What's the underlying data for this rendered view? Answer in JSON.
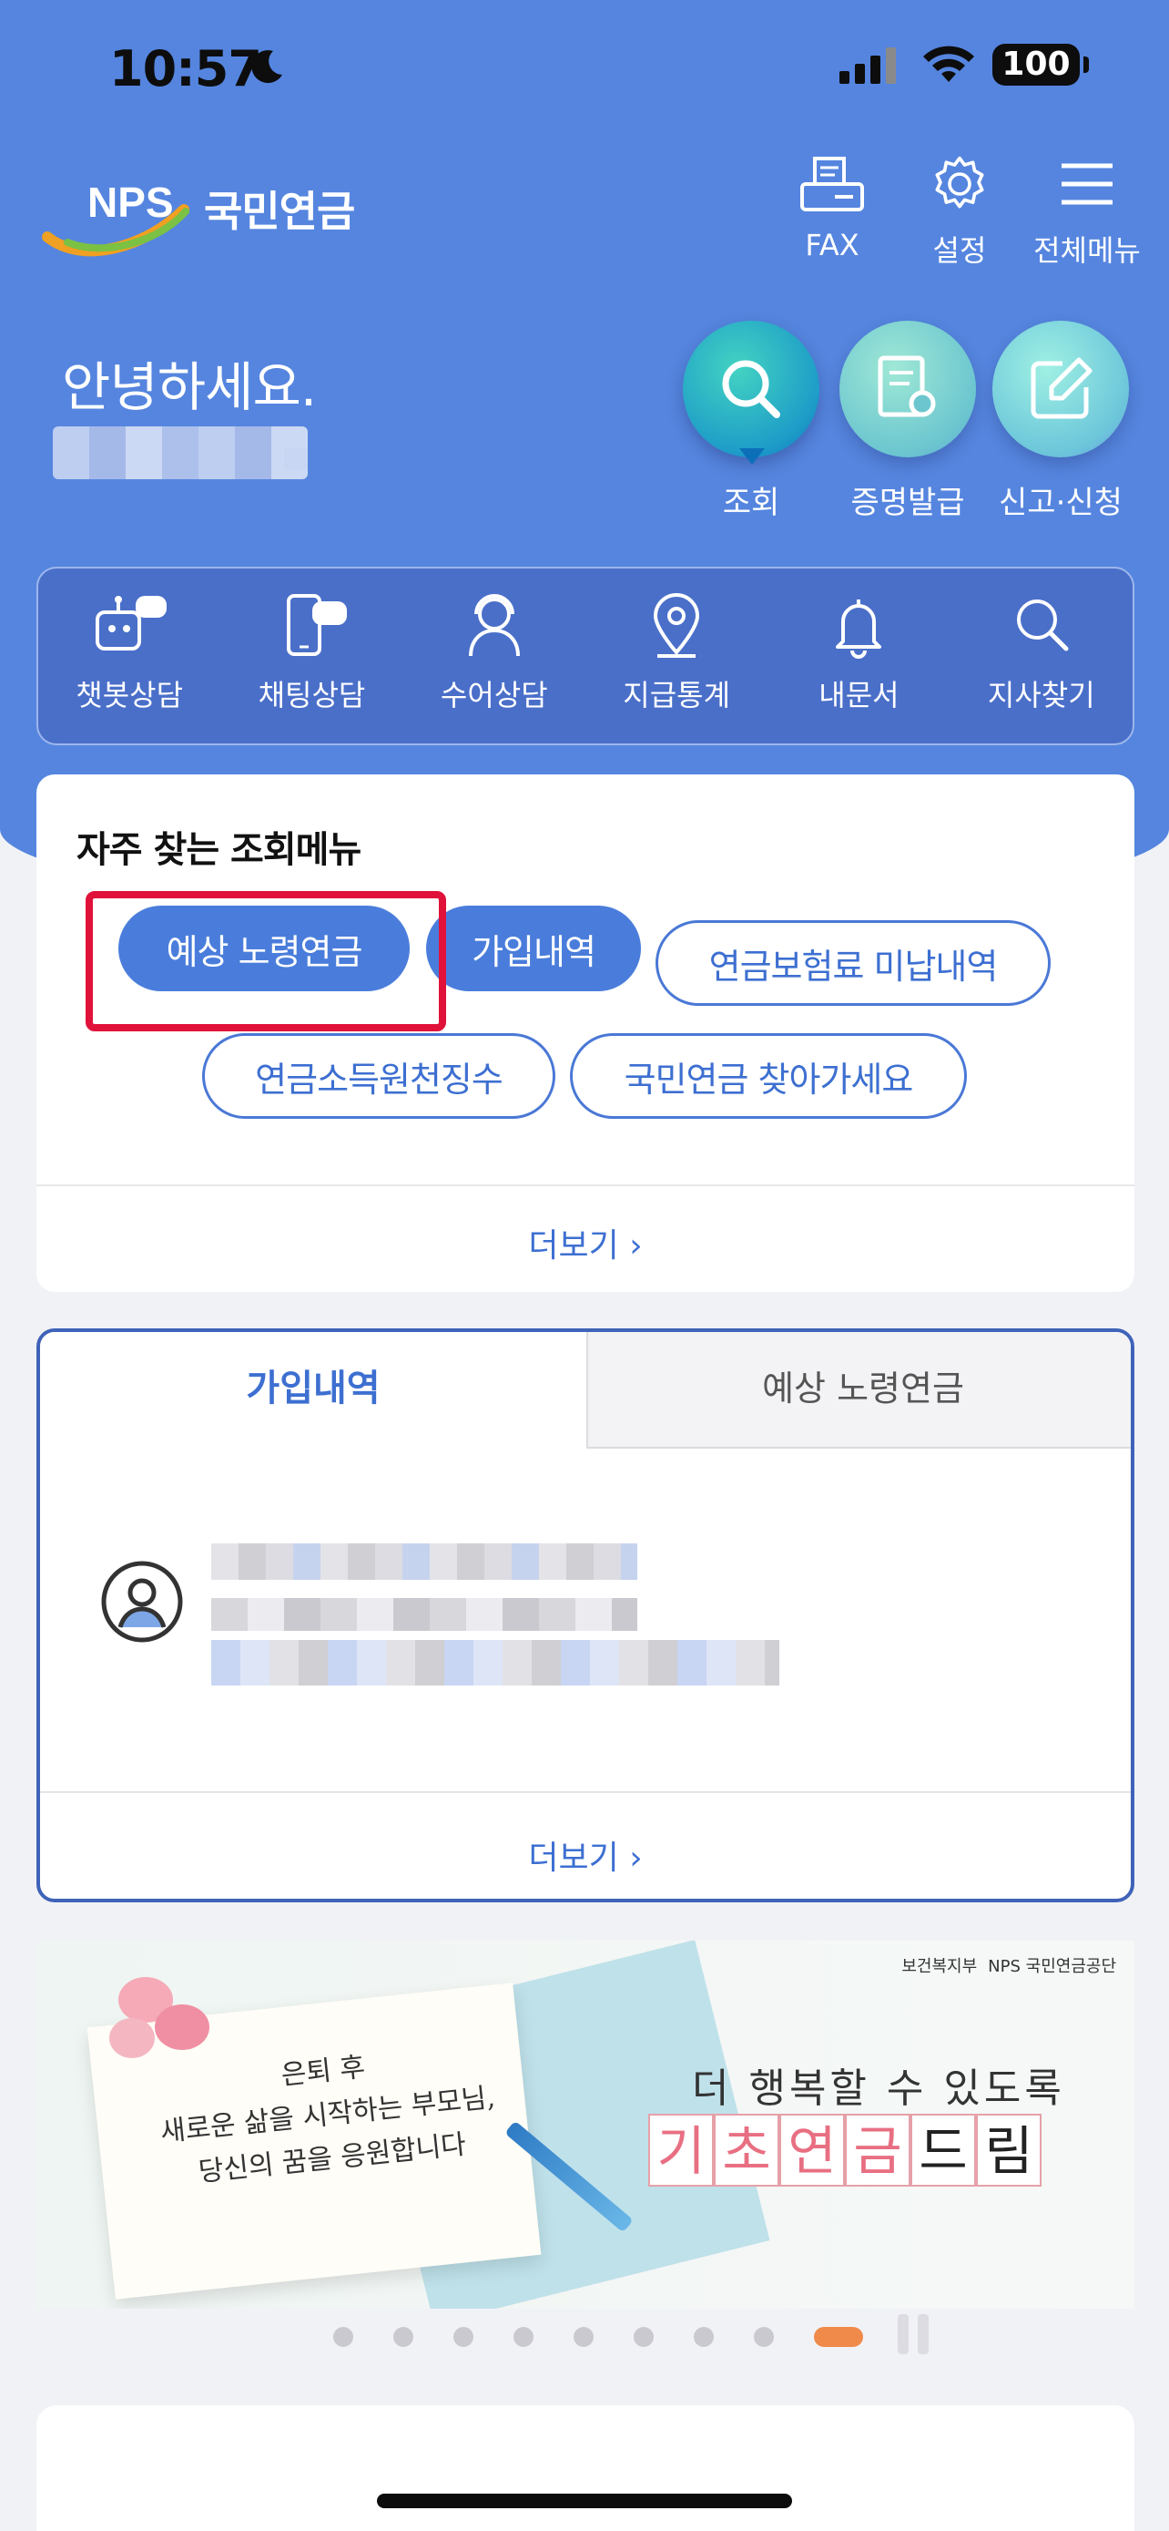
{
  "status_bar": {
    "time": "10:57",
    "battery": "100"
  },
  "header": {
    "logo_text": "NPS 국민연금",
    "actions": [
      {
        "label": "FAX",
        "icon": "fax-icon"
      },
      {
        "label": "설정",
        "icon": "gear-icon"
      },
      {
        "label": "전체메뉴",
        "icon": "hamburger-menu-icon"
      }
    ]
  },
  "greeting": {
    "text": "안녕하세요."
  },
  "quick_menu": [
    {
      "label": "조회",
      "icon": "search-icon"
    },
    {
      "label": "증명발급",
      "icon": "certificate-icon"
    },
    {
      "label": "신고·신청",
      "icon": "edit-icon"
    }
  ],
  "services": [
    {
      "label": "챗봇상담",
      "icon": "chatbot-icon"
    },
    {
      "label": "채팅상담",
      "icon": "chat-phone-icon"
    },
    {
      "label": "수어상담",
      "icon": "sign-language-icon"
    },
    {
      "label": "지급통계",
      "icon": "location-pin-icon"
    },
    {
      "label": "내문서",
      "icon": "bell-icon"
    },
    {
      "label": "지사찾기",
      "icon": "search-icon"
    }
  ],
  "frequent": {
    "title": "자주 찾는 조회메뉴",
    "chips": [
      "예상 노령연금",
      "가입내역",
      "연금보험료 미납내역",
      "연금소득원천징수",
      "국민연금 찾아가세요"
    ],
    "more": "더보기"
  },
  "tabs_card": {
    "tabs": [
      "가입내역",
      "예상 노령연금"
    ],
    "more": "더보기"
  },
  "banner": {
    "logos": [
      "보건복지부",
      "NPS 국민연금공단"
    ],
    "letter_lines": [
      "은퇴 후",
      "새로운 삶을 시작하는 부모님,",
      "당신의 꿈을 응원합니다"
    ],
    "tagline": "더 행복할 수 있도록",
    "boxes": [
      "기",
      "초",
      "연",
      "금",
      "드",
      "림"
    ]
  },
  "pager": {
    "count": 9,
    "active_index": 8
  },
  "colors": {
    "primary": "#5585df",
    "accent": "#3d6fd1",
    "highlight": "#e0123a",
    "pager_active": "#f08a4b"
  }
}
